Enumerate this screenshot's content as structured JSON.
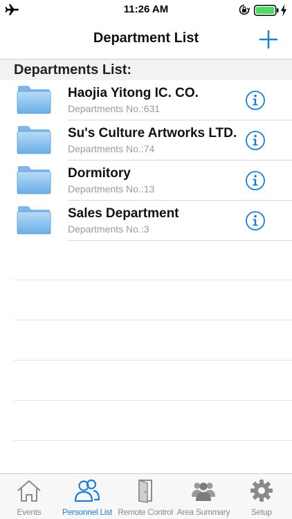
{
  "status_bar": {
    "time": "11:26 AM"
  },
  "nav": {
    "title": "Department List"
  },
  "section": {
    "header": "Departments List:"
  },
  "departments": [
    {
      "name": "Haojia Yitong IC. CO.",
      "number": "Departments No.:631"
    },
    {
      "name": "Su's Culture Artworks LTD.",
      "number": "Departments No.:74"
    },
    {
      "name": "Dormitory",
      "number": "Departments No.:13"
    },
    {
      "name": "Sales Department",
      "number": "Departments No.:3"
    }
  ],
  "tabs": [
    {
      "label": "Events",
      "icon": "house-icon"
    },
    {
      "label": "Personnel List",
      "icon": "people-icon",
      "active": true
    },
    {
      "label": "Remote Control",
      "icon": "door-icon"
    },
    {
      "label": "Area Summary",
      "icon": "group-icon"
    },
    {
      "label": "Setup",
      "icon": "gear-icon"
    }
  ],
  "colors": {
    "accent": "#1a7fd6",
    "inactive": "#8a8a8a",
    "folder": "#8ec2f0"
  }
}
